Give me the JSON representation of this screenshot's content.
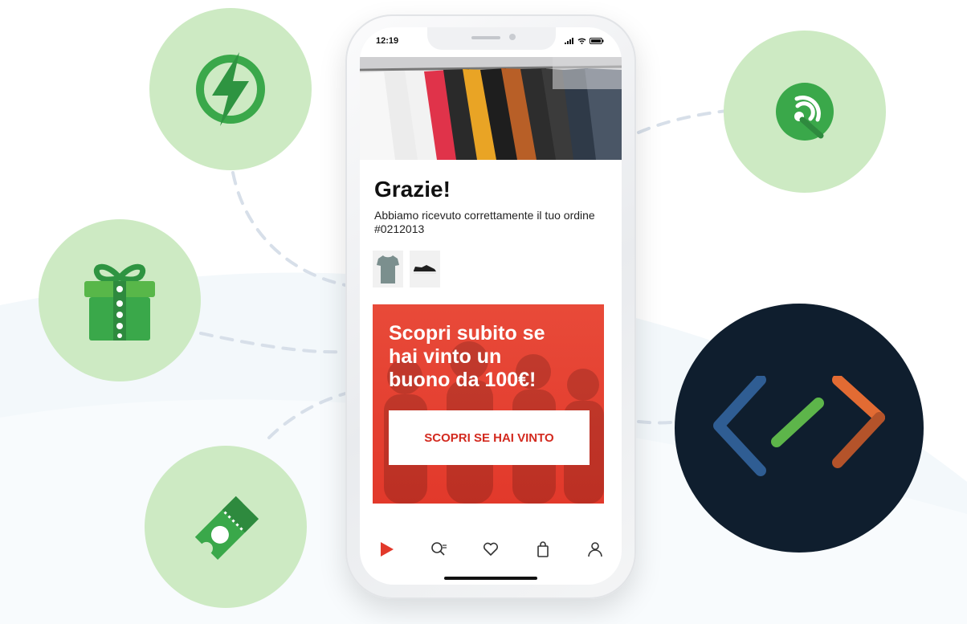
{
  "status_bar": {
    "time": "12:19"
  },
  "confirmation": {
    "title": "Grazie!",
    "message": "Abbiamo ricevuto correttamente il tuo ordine #0212013"
  },
  "order_items": [
    {
      "name": "tshirt-thumbnail"
    },
    {
      "name": "shoe-thumbnail"
    }
  ],
  "promo": {
    "headline": "Scopri subito se\nhai vinto un\nbuono da 100€!",
    "button_label": "SCOPRI SE HAI VINTO"
  },
  "tab_bar": [
    {
      "name": "play-icon",
      "active": true
    },
    {
      "name": "search-icon",
      "active": false
    },
    {
      "name": "heart-icon",
      "active": false
    },
    {
      "name": "bag-icon",
      "active": false
    },
    {
      "name": "user-icon",
      "active": false
    }
  ],
  "feature_icons": [
    "lightning-icon",
    "gift-icon",
    "ticket-icon",
    "nfc-icon",
    "code-icon"
  ],
  "colors": {
    "bubble_green": "#cdeac3",
    "icon_green": "#3aa84a",
    "promo_red": "#e2392b",
    "dark_circle": "#0f1e2e",
    "code_blue": "#2f5d93",
    "code_green": "#5db54a",
    "code_orange": "#e26b33"
  }
}
